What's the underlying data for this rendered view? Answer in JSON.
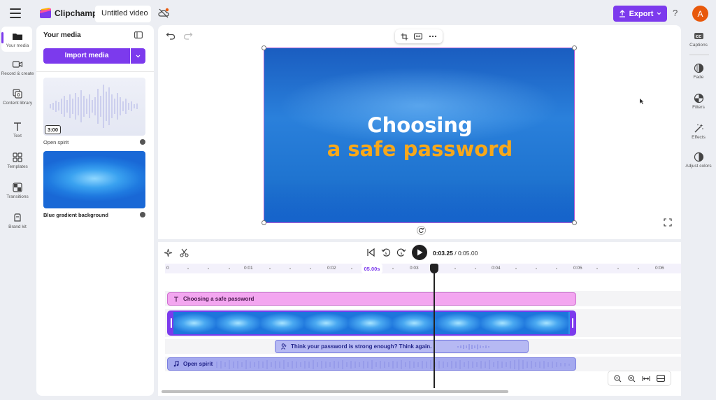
{
  "app": {
    "brand": "Clipchamp",
    "project_title": "Untitled video"
  },
  "header": {
    "export_label": "Export",
    "help": "?",
    "avatar_initial": "A"
  },
  "left_rail": [
    {
      "label": "Your media",
      "icon": "folder-icon"
    },
    {
      "label": "Record & create",
      "icon": "camera-icon"
    },
    {
      "label": "Content library",
      "icon": "library-icon"
    },
    {
      "label": "Text",
      "icon": "text-icon"
    },
    {
      "label": "Templates",
      "icon": "templates-icon"
    },
    {
      "label": "Transitions",
      "icon": "transitions-icon"
    },
    {
      "label": "Brand kit",
      "icon": "brand-kit-icon"
    }
  ],
  "media_panel": {
    "title": "Your media",
    "import_label": "Import media",
    "items": [
      {
        "name": "Open spirit",
        "duration": "3:00",
        "type": "audio"
      },
      {
        "name": "Blue gradient background",
        "type": "video"
      }
    ]
  },
  "preview": {
    "line1": "Choosing",
    "line2": "a safe password",
    "line2_color": "#f7a81b"
  },
  "playback": {
    "current": "0:03.25",
    "separator": " / ",
    "total": "0:05.00"
  },
  "ruler": {
    "ticks": [
      "0",
      "0:01",
      "0:02",
      "0:03",
      "0:04",
      "0:05",
      "0:06"
    ],
    "highlight": "05.00s"
  },
  "tracks": {
    "text_clip": "Choosing a safe password",
    "voiceover_clip": "Think your password is strong enough? Think again.",
    "audio_clip": "Open spirit"
  },
  "right_rail": [
    {
      "label": "Captions",
      "icon": "captions-icon"
    },
    {
      "label": "Fade",
      "icon": "fade-icon"
    },
    {
      "label": "Filters",
      "icon": "filters-icon"
    },
    {
      "label": "Effects",
      "icon": "effects-icon"
    },
    {
      "label": "Adjust colors",
      "icon": "adjust-colors-icon"
    }
  ],
  "colors": {
    "accent": "#7c3aed",
    "avatar": "#e8590c"
  }
}
